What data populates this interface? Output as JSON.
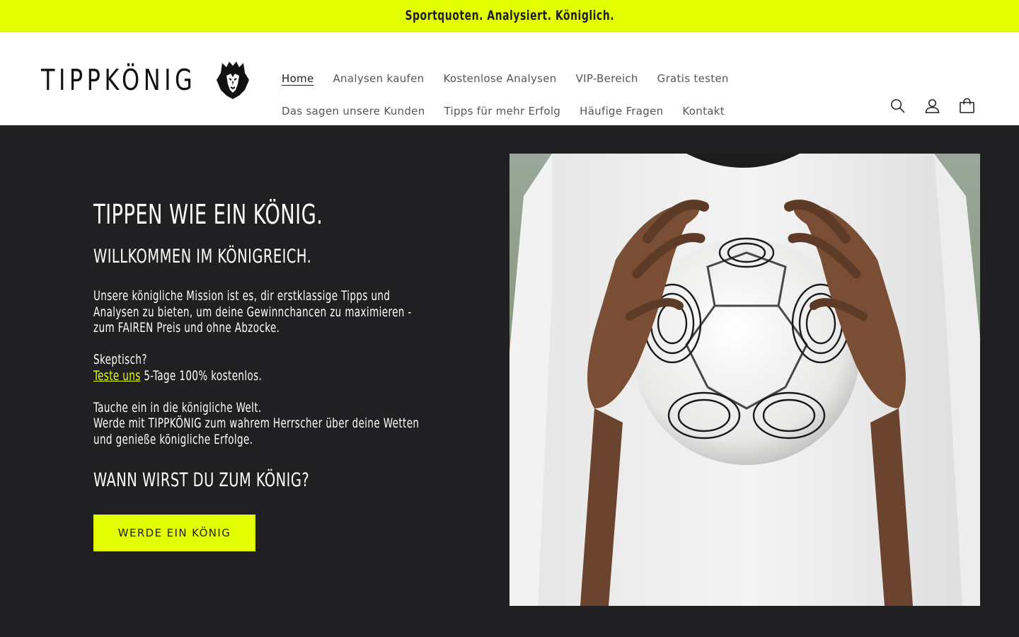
{
  "announcement": {
    "text": "Sportquoten. Analysiert. Königlich."
  },
  "brand": {
    "name": "TIPPKÖNIG",
    "accent": "#e3ff00",
    "dark": "#202023"
  },
  "nav": {
    "row1": [
      {
        "label": "Home",
        "active": true
      },
      {
        "label": "Analysen kaufen"
      },
      {
        "label": "Kostenlose Analysen"
      },
      {
        "label": "VIP-Bereich"
      },
      {
        "label": "Gratis testen"
      }
    ],
    "row2": [
      {
        "label": "Das sagen unsere Kunden"
      },
      {
        "label": "Tipps für mehr Erfolg"
      },
      {
        "label": "Häufige Fragen"
      },
      {
        "label": "Kontakt"
      }
    ]
  },
  "header_icons": [
    "search-icon",
    "account-icon",
    "cart-icon"
  ],
  "hero": {
    "title": "TIPPEN WIE EIN KÖNIG.",
    "subtitle": "WILLKOMMEN IM KÖNIGREICH.",
    "mission_line1": "Unsere königliche Mission ist es, dir erstklassige Tipps und",
    "mission_line2": "Analysen zu bieten, um deine Gewinnchancen zu maximieren -",
    "mission_line3": "zum FAIREN Preis und ohne Abzocke.",
    "skeptic": "Skeptisch?",
    "test_link": "Teste uns",
    "test_rest": " 5-Tage 100% kostenlos.",
    "dive_line1": "Tauche ein in die königliche Welt.",
    "dive_line2": "Werde mit TIPPKÖNIG zum wahrem Herrscher über deine Wetten",
    "dive_line3": "und genieße königliche Erfolge.",
    "question": "WANN WIRST DU ZUM KÖNIG?",
    "cta": "WERDE EIN KÖNIG"
  }
}
